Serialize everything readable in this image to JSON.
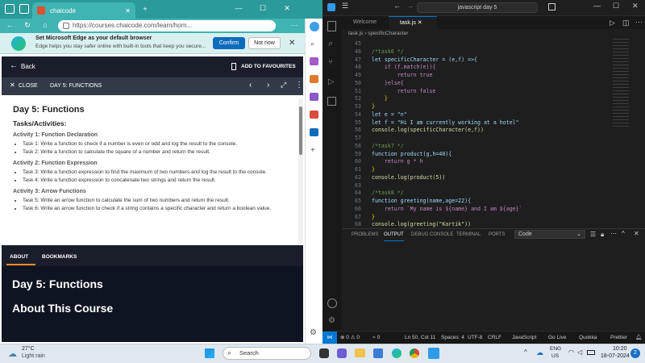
{
  "edge": {
    "tab_title": "chaicode",
    "url": "https://courses.chaicode.com/learn/hom...",
    "banner_title": "Set Microsoft Edge as your default browser",
    "banner_sub": "Edge helps you stay safer online with built-in tools that keep you secure...",
    "confirm": "Confirm",
    "not_now": "Not now"
  },
  "course": {
    "back": "Back",
    "add_fav": "ADD TO FAVOURITES",
    "close": "CLOSE",
    "lesson": "DAY 5: FUNCTIONS",
    "title": "Day 5: Functions",
    "tasks_heading": "Tasks/Activities:",
    "sections": [
      {
        "heading": "Activity 1: Function Declaration",
        "items": [
          "Task 1: Write a function to check if a number is even or odd and log the result to the console.",
          "Task 2: Write a function to calculate the square of a number and return the result."
        ]
      },
      {
        "heading": "Activity 2: Function Expression",
        "items": [
          "Task 3: Write a function expression to find the maximum of two numbers and log the result to the console.",
          "Task 4: Write a function expression to concatenate two strings and return the result."
        ]
      },
      {
        "heading": "Activity 3: Arrow Functions",
        "items": [
          "Task 5: Write an arrow function to calculate the sum of two numbers and return the result.",
          "Task 6: Write an arrow function to check if a string contains a specific character and return a boolean value."
        ]
      }
    ],
    "tab_about": "ABOUT",
    "tab_bookmarks": "BOOKMARKS",
    "bottom_title": "Day 5: Functions",
    "bottom_sub": "About This Course"
  },
  "vscode": {
    "search": "javascript day 5",
    "tab_welcome": "Welcome",
    "tab_file": "task.js",
    "breadcrumb_file": "task.js",
    "breadcrumb_symbol": "specificCharacter",
    "lines": [
      {
        "n": "45",
        "t": ""
      },
      {
        "n": "46",
        "t": "/*task6 */"
      },
      {
        "n": "47",
        "t": "let specificCharacter = (e,f) =>{"
      },
      {
        "n": "48",
        "t": "    if (f.match(e)){"
      },
      {
        "n": "49",
        "t": "        return true"
      },
      {
        "n": "50",
        "t": "    }else{"
      },
      {
        "n": "51",
        "t": "        return false"
      },
      {
        "n": "52",
        "t": "    }"
      },
      {
        "n": "53",
        "t": "}"
      },
      {
        "n": "54",
        "t": "let e = \"n\""
      },
      {
        "n": "55",
        "t": "let f = \"Hi I am currently working at a hotel\""
      },
      {
        "n": "56",
        "t": "console.log(specificCharacter(e,f))"
      },
      {
        "n": "57",
        "t": ""
      },
      {
        "n": "58",
        "t": "/*task7 */"
      },
      {
        "n": "59",
        "t": "function product(g,h=40){"
      },
      {
        "n": "60",
        "t": "    return g * h"
      },
      {
        "n": "61",
        "t": "}"
      },
      {
        "n": "62",
        "t": "console.log(product(5))"
      },
      {
        "n": "63",
        "t": ""
      },
      {
        "n": "64",
        "t": "/*task8 */"
      },
      {
        "n": "65",
        "t": "function greeting(name,age=22){"
      },
      {
        "n": "66",
        "t": "    return `My name is ${name} and I am ${age}`"
      },
      {
        "n": "67",
        "t": "}"
      },
      {
        "n": "68",
        "t": "console.log(greeting(\"Kartik\"))"
      }
    ],
    "panel_tabs": [
      "PROBLEMS",
      "OUTPUT",
      "DEBUG CONSOLE",
      "TERMINAL",
      "PORTS"
    ],
    "output_channel": "Code",
    "status": {
      "errors": "0",
      "warnings": "0",
      "ports": "0",
      "position": "Ln 50, Col 11",
      "spaces": "Spaces: 4",
      "encoding": "UTF-8",
      "eol": "CRLF",
      "language": "JavaScript",
      "golive": "Go Live",
      "quokka": "Quokka",
      "prettier": "Prettier"
    }
  },
  "taskbar": {
    "temp": "27°C",
    "weather": "Light rain",
    "search": "Search",
    "lang1": "ENG",
    "lang2": "US",
    "time": "10:20",
    "date": "18-07-2024",
    "notif": "2"
  },
  "colors": {
    "edge_teal": "#40b3b3",
    "vs_accent": "#0078d4",
    "course_dark": "#1a1e2b"
  }
}
